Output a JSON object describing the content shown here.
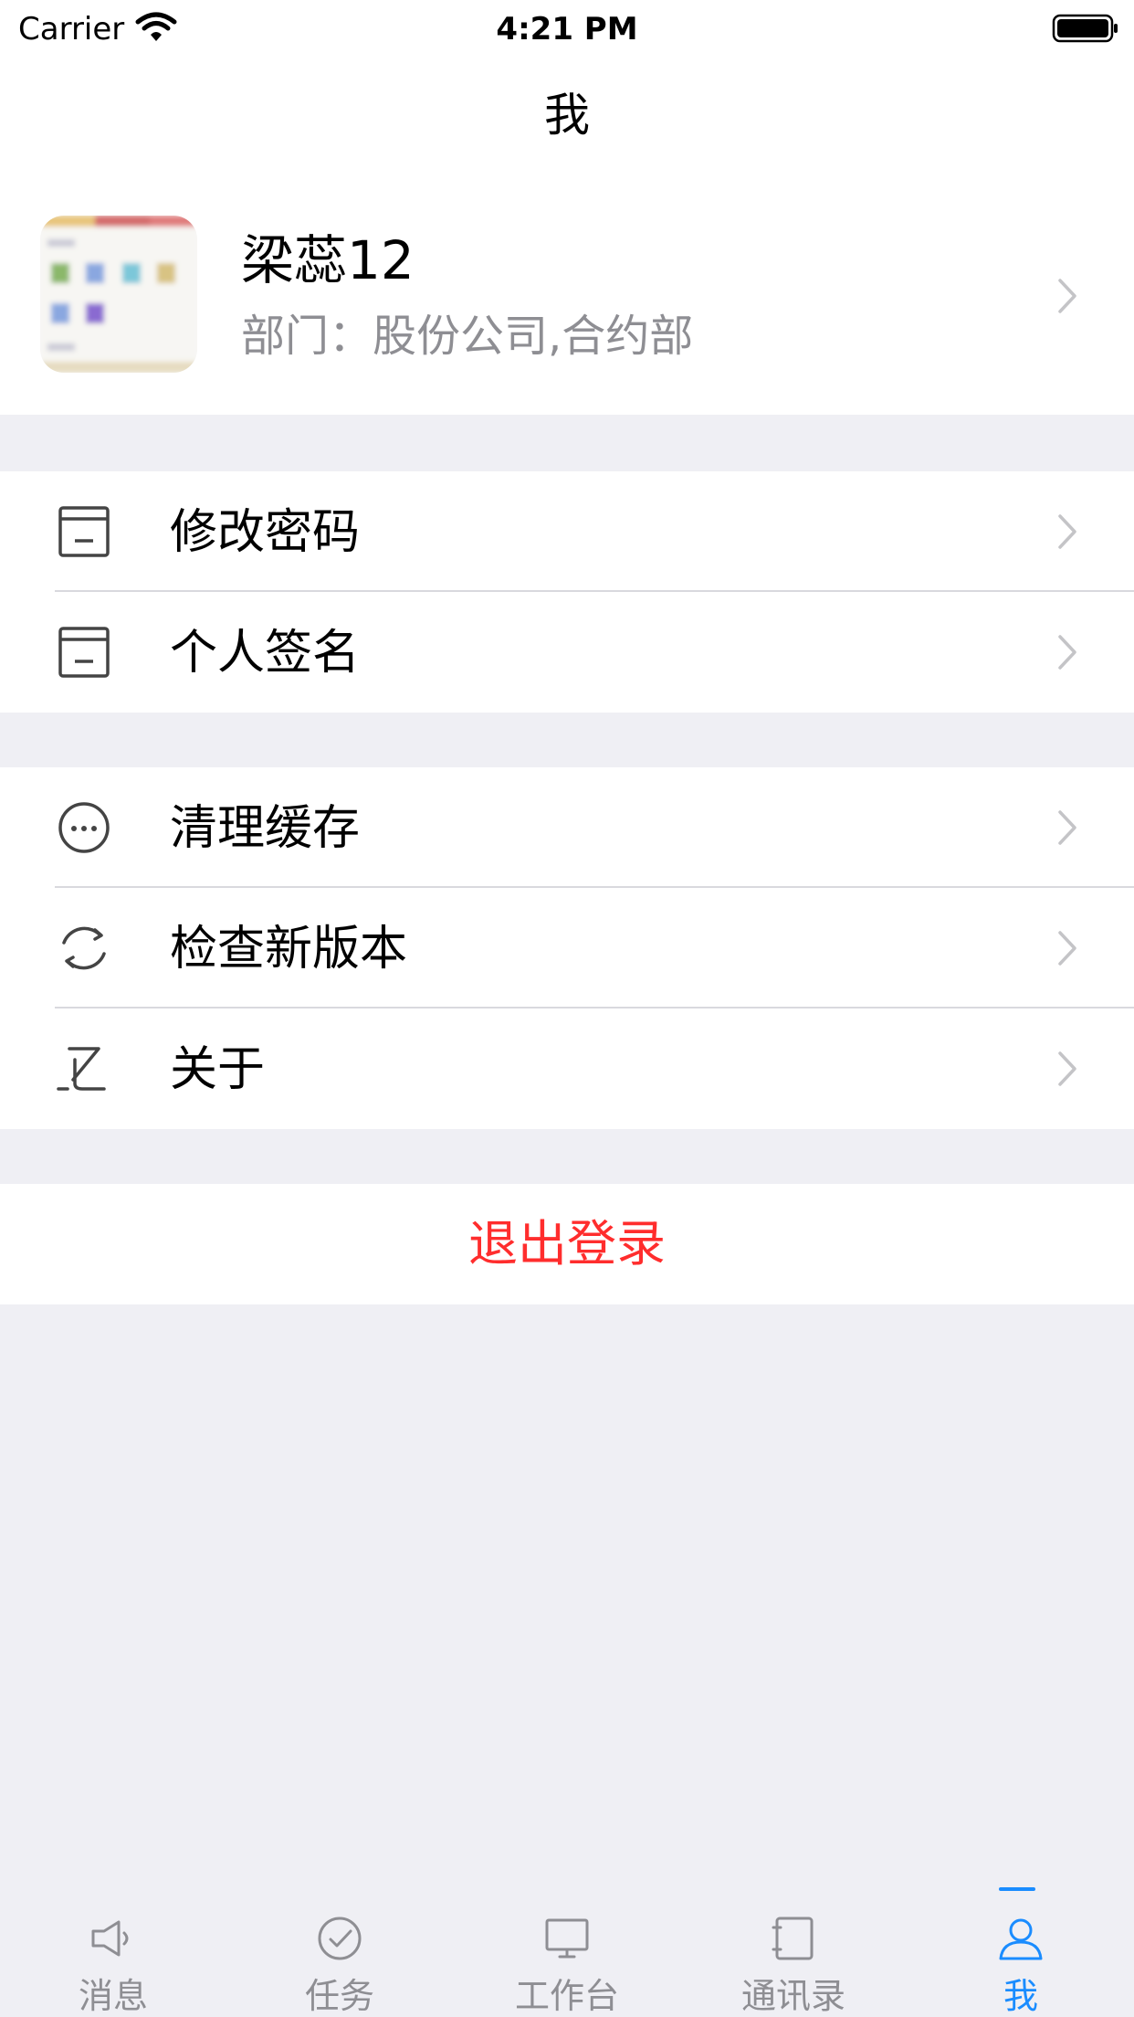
{
  "status_bar": {
    "carrier": "Carrier",
    "time": "4:21 PM"
  },
  "nav": {
    "title": "我"
  },
  "profile": {
    "name": "梁蕊12",
    "department": "部门：股份公司,合约部"
  },
  "settings_group_1": [
    {
      "label": "修改密码",
      "icon": "document-icon"
    },
    {
      "label": "个人签名",
      "icon": "document-icon"
    }
  ],
  "settings_group_2": [
    {
      "label": "清理缓存",
      "icon": "more-circle-icon"
    },
    {
      "label": "检查新版本",
      "icon": "refresh-icon"
    },
    {
      "label": "关于",
      "icon": "about-icon"
    }
  ],
  "logout": {
    "label": "退出登录",
    "color": "#ff2d2d"
  },
  "tabs": [
    {
      "label": "消息",
      "icon": "megaphone-icon"
    },
    {
      "label": "任务",
      "icon": "check-circle-icon"
    },
    {
      "label": "工作台",
      "icon": "monitor-icon"
    },
    {
      "label": "通讯录",
      "icon": "contacts-book-icon"
    },
    {
      "label": "我",
      "icon": "person-icon",
      "active": true
    }
  ],
  "colors": {
    "accent": "#1a8cff",
    "background": "#efeff4",
    "secondary_text": "#8e8e93"
  }
}
